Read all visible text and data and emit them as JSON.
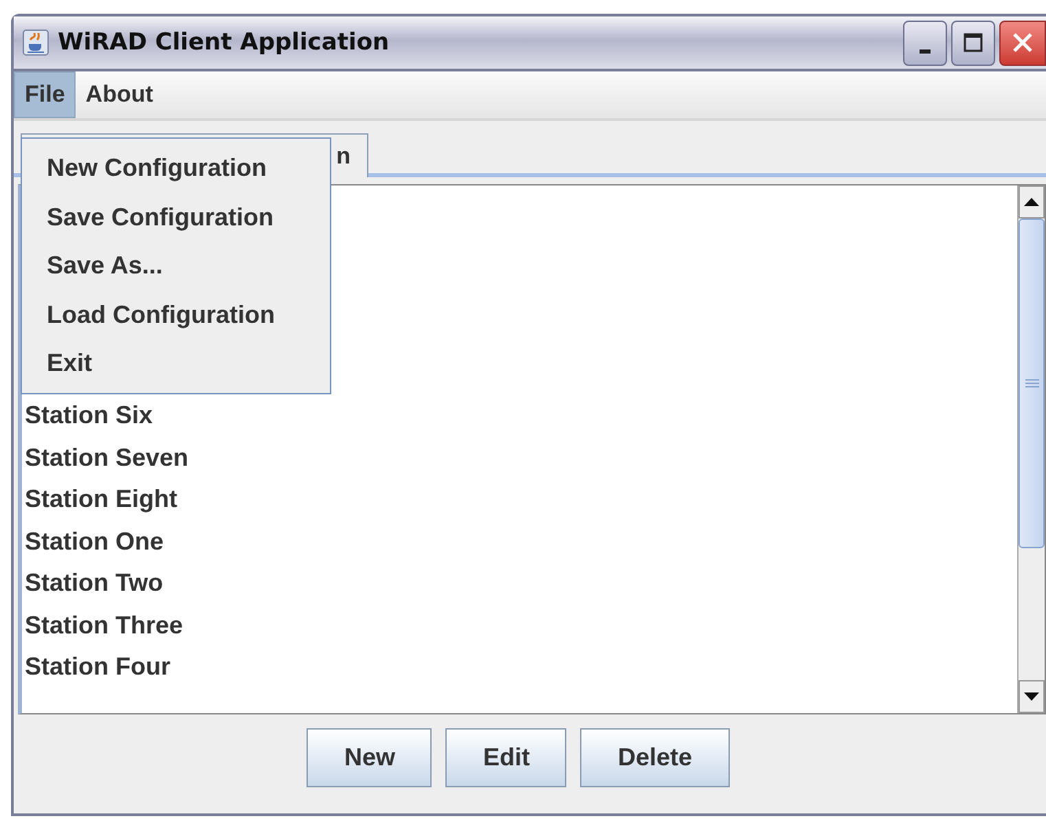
{
  "window": {
    "title": "WiRAD Client Application"
  },
  "menu_bar": [
    {
      "label": "File",
      "selected": true
    },
    {
      "label": "About",
      "selected": false
    }
  ],
  "file_menu": [
    "New Configuration",
    "Save Configuration",
    "Save As...",
    "Load Configuration",
    "Exit"
  ],
  "tabs": [
    {
      "label": "n",
      "selected": true
    }
  ],
  "stations": [
    "Station Six",
    "Station Seven",
    "Station Eight",
    "Station One",
    "Station Two",
    "Station Three",
    "Station Four"
  ],
  "buttons": [
    "New",
    "Edit",
    "Delete"
  ]
}
